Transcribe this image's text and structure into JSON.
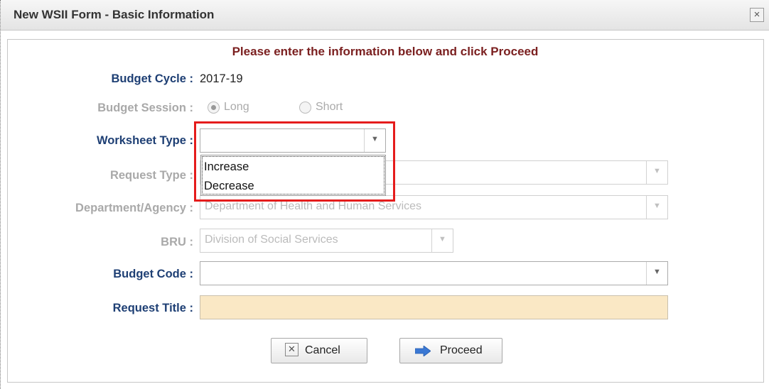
{
  "dialog": {
    "title": "New WSII Form - Basic Information",
    "close_glyph": "×"
  },
  "instruction": "Please enter the information below and click Proceed",
  "fields": {
    "budget_cycle": {
      "label": "Budget Cycle :",
      "value": "2017-19"
    },
    "budget_session": {
      "label": "Budget Session :",
      "options": [
        {
          "label": "Long",
          "selected": true
        },
        {
          "label": "Short",
          "selected": false
        }
      ]
    },
    "worksheet_type": {
      "label": "Worksheet Type :",
      "value": "",
      "dropdown_open": true,
      "options": [
        "Increase",
        "Decrease"
      ]
    },
    "request_type": {
      "label": "Request Type :",
      "value": ""
    },
    "department": {
      "label": "Department/Agency :",
      "value": "Department of Health and Human Services"
    },
    "bru": {
      "label": "BRU :",
      "value": "Division of Social Services"
    },
    "budget_code": {
      "label": "Budget Code :",
      "value": ""
    },
    "request_title": {
      "label": "Request Title :",
      "value": ""
    }
  },
  "buttons": {
    "cancel": "Cancel",
    "proceed": "Proceed"
  },
  "icons": {
    "close": "close-icon",
    "chevron": "chevron-down-icon",
    "cancel": "cancel-x-icon",
    "proceed": "arrow-right-icon"
  },
  "colors": {
    "label": "#1e3f74",
    "instruction": "#7b2020",
    "highlight": "#e51c1c",
    "title_field_bg": "#fae8c5",
    "arrow": "#3a78d4"
  }
}
